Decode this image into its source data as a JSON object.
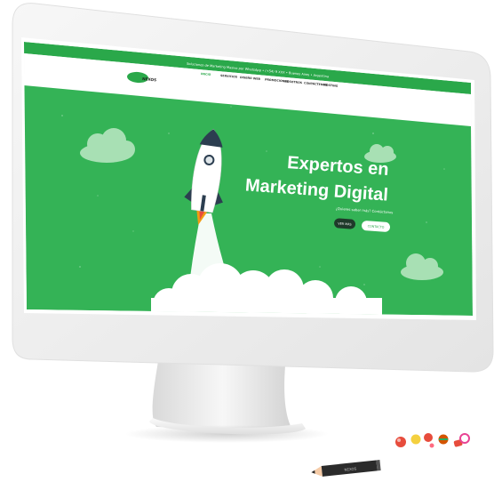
{
  "topbar": {
    "text": "Soluciones de Marketing Masivo por WhatsApp • (+54) 9 XXX • Buenos Aires • Argentina"
  },
  "nav": {
    "logo_text": "NEXOS",
    "items": [
      {
        "label": "INICIO",
        "active": true
      },
      {
        "label": "SERVICIOS",
        "active": false
      },
      {
        "label": "DISEÑO WEB",
        "active": false
      },
      {
        "label": "PROMOCIONES",
        "active": false
      },
      {
        "label": "NOSOTROS",
        "active": false
      },
      {
        "label": "CONTÁCTENOS",
        "active": false
      },
      {
        "label": "HOSTING",
        "active": false
      }
    ]
  },
  "hero": {
    "title_line1": "Expertos en",
    "title_line2": "Marketing Digital",
    "subtitle": "¿Quieres saber más? Contáctanos",
    "primary_button": "VER MÁS",
    "secondary_button": "CONTACTO"
  },
  "decor": {
    "pencil_label": "NEXOS"
  },
  "colors": {
    "brand_green": "#2aa84a",
    "hero_green": "#34b356",
    "light_green": "#a8e0b4",
    "frame": "#f2f2f2",
    "screen_bezel": "#ffffff"
  }
}
